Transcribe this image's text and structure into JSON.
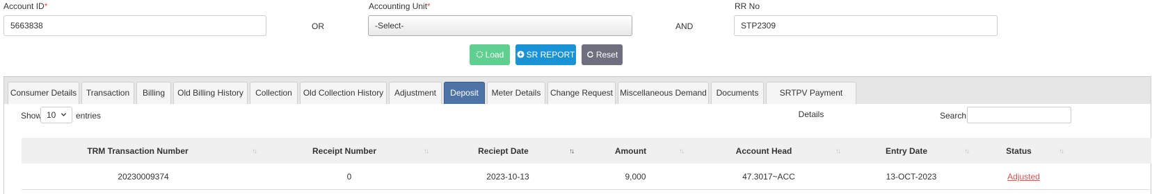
{
  "form": {
    "account_id": {
      "label": "Account ID",
      "required_mark": "*",
      "value": "5663838"
    },
    "or_text": "OR",
    "accounting_unit": {
      "label": "Accounting Unit",
      "required_mark": "*",
      "value": "-Select-"
    },
    "and_text": "AND",
    "rr_no": {
      "label": "RR No",
      "value": "STP2309"
    }
  },
  "buttons": {
    "load": {
      "label": "Load",
      "color": "#5fd08f"
    },
    "sr_report": {
      "label": "SR REPORT",
      "color": "#1a92d6"
    },
    "reset": {
      "label": "Reset",
      "color": "#6f6f7f"
    }
  },
  "tabs": [
    {
      "label": "Consumer Details"
    },
    {
      "label": "Transaction"
    },
    {
      "label": "Billing"
    },
    {
      "label": "Old Billing History"
    },
    {
      "label": "Collection"
    },
    {
      "label": "Old Collection History"
    },
    {
      "label": "Adjustment"
    },
    {
      "label": "Deposit",
      "active": true
    },
    {
      "label": "Meter Details"
    },
    {
      "label": "Change Request"
    },
    {
      "label": "Miscellaneous Demand"
    },
    {
      "label": "Documents"
    },
    {
      "label": "SRTPV Payment Details"
    }
  ],
  "table_controls": {
    "show_label": "Show",
    "page_size": "10",
    "entries_label": "entries",
    "search_label": "Search:",
    "search_value": ""
  },
  "table": {
    "headers": [
      "TRM Transaction Number",
      "Receipt Number",
      "Reciept Date",
      "Amount",
      "Account Head",
      "Entry Date",
      "Status"
    ],
    "sorted_column": "Reciept Date",
    "rows": [
      [
        "20230009374",
        "0",
        "2023-10-13",
        "9,000",
        "47.3017~ACC",
        "13-OCT-2023",
        "Adjusted"
      ]
    ]
  },
  "icons": [
    "spinner-icon",
    "download-icon",
    "refresh-icon",
    "chevron-down-icon",
    "sort-icon"
  ]
}
